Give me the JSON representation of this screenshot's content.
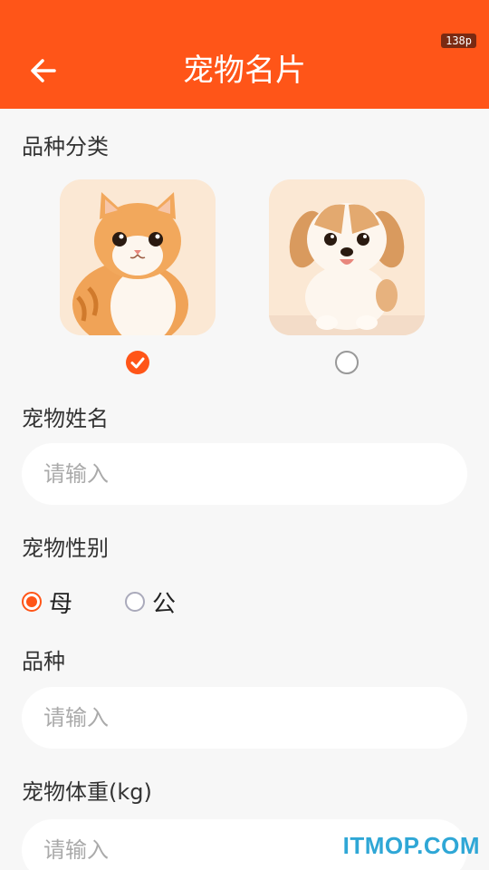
{
  "header": {
    "title": "宠物名片",
    "back_icon": "arrow-left-icon",
    "badge": "138p",
    "color": "#ff5518"
  },
  "breed_category": {
    "label": "品种分类",
    "options": [
      {
        "name": "cat",
        "selected": true
      },
      {
        "name": "dog",
        "selected": false
      }
    ]
  },
  "pet_name": {
    "label": "宠物姓名",
    "placeholder": "请输入",
    "value": ""
  },
  "pet_gender": {
    "label": "宠物性别",
    "options": [
      {
        "label": "母",
        "selected": true
      },
      {
        "label": "公",
        "selected": false
      }
    ]
  },
  "breed": {
    "label": "品种",
    "placeholder": "请输入",
    "value": ""
  },
  "weight": {
    "label": "宠物体重(kg)",
    "placeholder": "请输入",
    "value": ""
  },
  "watermark": "ITMOP.COM"
}
